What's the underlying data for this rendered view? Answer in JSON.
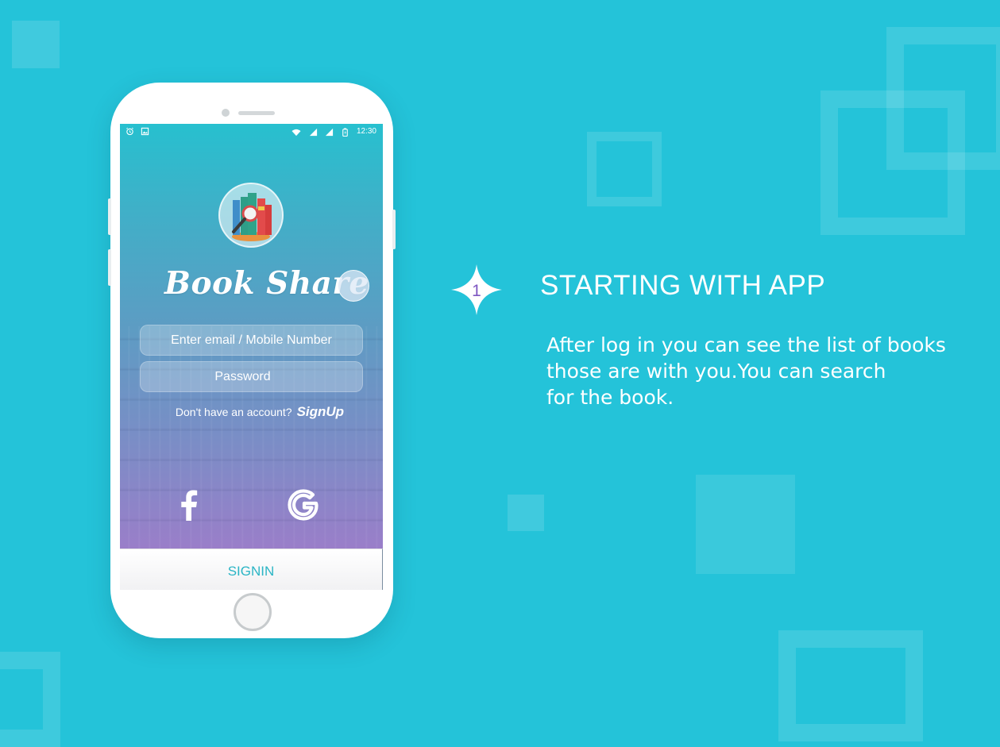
{
  "status_bar": {
    "time": "12:30"
  },
  "app": {
    "title": "Book Share",
    "email_placeholder": "Enter email  / Mobile Number",
    "password_placeholder": "Password",
    "no_account_text": "Don't have an account?",
    "signup_label": "SignUp",
    "signin_label": "SIGNIN",
    "social": [
      "facebook-icon",
      "google-icon"
    ]
  },
  "step": {
    "number": "1",
    "heading": "STARTING WITH APP",
    "description_lines": [
      "After log in  you can see the list of books",
      "those are with you.You can search",
      "for the book."
    ]
  },
  "colors": {
    "background": "#24c3d9",
    "accent": "#2bb5c5",
    "step_number": "#7e57c2"
  }
}
